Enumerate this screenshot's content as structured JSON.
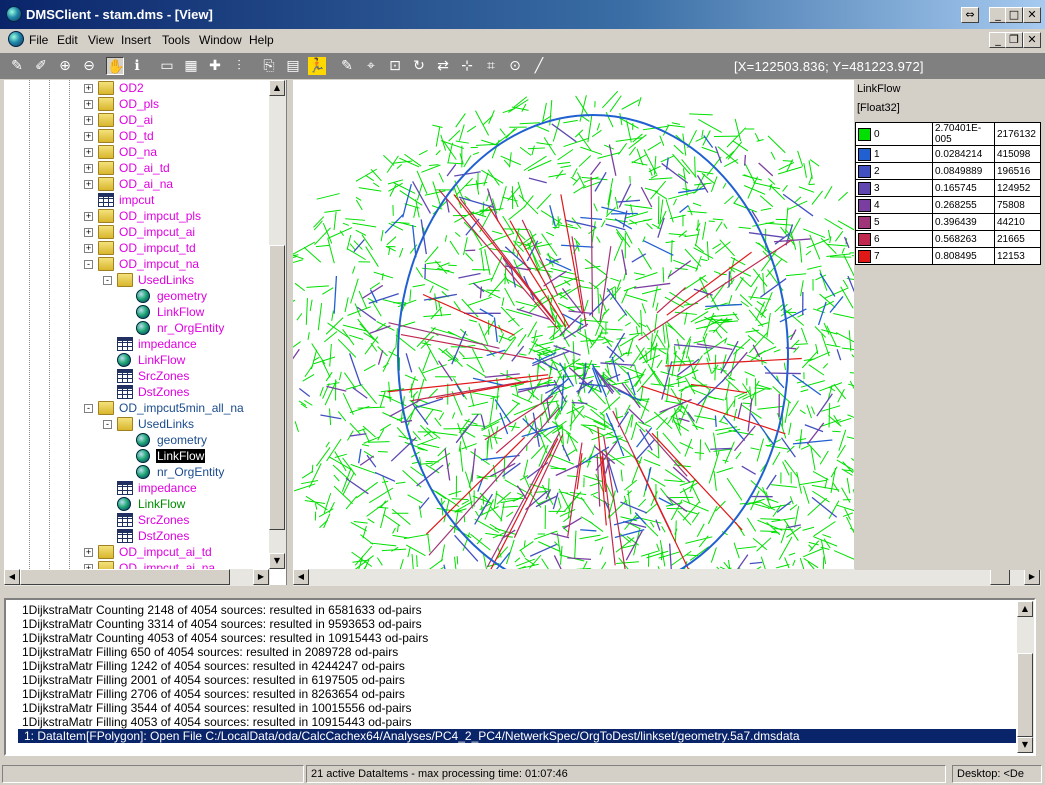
{
  "window": {
    "title": "DMSClient - stam.dms - [View]"
  },
  "menu": [
    "File",
    "Edit",
    "View",
    "Insert",
    "Tools",
    "Window",
    "Help"
  ],
  "toolbar": {
    "coordinates": "[X=122503.836; Y=481223.972]",
    "icons": [
      "pen-icon",
      "edit-pen-icon",
      "zoom-in-icon",
      "zoom-out-icon",
      "hand-pan-icon",
      "info-icon",
      "rectangle-icon",
      "grid-icon",
      "crosshair-icon",
      "split-icon",
      "copy-icon",
      "paste-icon",
      "runner-icon",
      "pen2-icon",
      "dot-icon",
      "select-icon",
      "rotate-icon",
      "move-icon",
      "node-icon",
      "point-icon",
      "target-icon",
      "line-icon"
    ]
  },
  "tree": [
    {
      "label": "OD2",
      "color": "mag",
      "icon": "folder",
      "indent": 0,
      "exp": "+"
    },
    {
      "label": "OD_pls",
      "color": "mag",
      "icon": "folder",
      "indent": 0,
      "exp": "+"
    },
    {
      "label": "OD_ai",
      "color": "mag",
      "icon": "folder",
      "indent": 0,
      "exp": "+"
    },
    {
      "label": "OD_td",
      "color": "mag",
      "icon": "folder",
      "indent": 0,
      "exp": "+"
    },
    {
      "label": "OD_na",
      "color": "mag",
      "icon": "folder",
      "indent": 0,
      "exp": "+"
    },
    {
      "label": "OD_ai_td",
      "color": "mag",
      "icon": "folder",
      "indent": 0,
      "exp": "+"
    },
    {
      "label": "OD_ai_na",
      "color": "mag",
      "icon": "folder",
      "indent": 0,
      "exp": "+"
    },
    {
      "label": "impcut",
      "color": "mag",
      "icon": "table",
      "indent": 0,
      "exp": ""
    },
    {
      "label": "OD_impcut_pls",
      "color": "mag",
      "icon": "folder",
      "indent": 0,
      "exp": "+"
    },
    {
      "label": "OD_impcut_ai",
      "color": "mag",
      "icon": "folder",
      "indent": 0,
      "exp": "+"
    },
    {
      "label": "OD_impcut_td",
      "color": "mag",
      "icon": "folder",
      "indent": 0,
      "exp": "+"
    },
    {
      "label": "OD_impcut_na",
      "color": "mag",
      "icon": "folder",
      "indent": 0,
      "exp": "-"
    },
    {
      "label": "UsedLinks",
      "color": "mag",
      "icon": "folder",
      "indent": 1,
      "exp": "-"
    },
    {
      "label": "geometry",
      "color": "mag",
      "icon": "globe",
      "indent": 2,
      "exp": ""
    },
    {
      "label": "LinkFlow",
      "color": "mag",
      "icon": "globe",
      "indent": 2,
      "exp": ""
    },
    {
      "label": "nr_OrgEntity",
      "color": "mag",
      "icon": "globe",
      "indent": 2,
      "exp": ""
    },
    {
      "label": "impedance",
      "color": "mag",
      "icon": "table",
      "indent": 1,
      "exp": ""
    },
    {
      "label": "LinkFlow",
      "color": "mag",
      "icon": "globe",
      "indent": 1,
      "exp": ""
    },
    {
      "label": "SrcZones",
      "color": "mag",
      "icon": "table",
      "indent": 1,
      "exp": ""
    },
    {
      "label": "DstZones",
      "color": "mag",
      "icon": "table",
      "indent": 1,
      "exp": ""
    },
    {
      "label": "OD_impcut5min_all_na",
      "color": "blu",
      "icon": "folder",
      "indent": 0,
      "exp": "-"
    },
    {
      "label": "UsedLinks",
      "color": "blu",
      "icon": "folder",
      "indent": 1,
      "exp": "-"
    },
    {
      "label": "geometry",
      "color": "blu",
      "icon": "globe",
      "indent": 2,
      "exp": ""
    },
    {
      "label": "LinkFlow",
      "color": "sel",
      "icon": "globe",
      "indent": 2,
      "exp": ""
    },
    {
      "label": "nr_OrgEntity",
      "color": "blu",
      "icon": "globe",
      "indent": 2,
      "exp": ""
    },
    {
      "label": "impedance",
      "color": "mag",
      "icon": "table",
      "indent": 1,
      "exp": ""
    },
    {
      "label": "LinkFlow",
      "color": "grn",
      "icon": "globe",
      "indent": 1,
      "exp": ""
    },
    {
      "label": "SrcZones",
      "color": "mag",
      "icon": "table",
      "indent": 1,
      "exp": ""
    },
    {
      "label": "DstZones",
      "color": "mag",
      "icon": "table",
      "indent": 1,
      "exp": ""
    },
    {
      "label": "OD_impcut_ai_td",
      "color": "mag",
      "icon": "folder",
      "indent": 0,
      "exp": "+"
    },
    {
      "label": "OD_impcut_ai_na",
      "color": "mag",
      "icon": "folder",
      "indent": 0,
      "exp": "+"
    }
  ],
  "legend": {
    "title": "LinkFlow",
    "type": "[Float32]",
    "rows": [
      {
        "cls": "0",
        "value": "2.70401E-005",
        "count": "2176132",
        "color": "#00e000"
      },
      {
        "cls": "1",
        "value": "0.0284214",
        "count": "415098",
        "color": "#2060d0"
      },
      {
        "cls": "2",
        "value": "0.0849889",
        "count": "196516",
        "color": "#4050c0"
      },
      {
        "cls": "3",
        "value": "0.165745",
        "count": "124952",
        "color": "#6048b0"
      },
      {
        "cls": "4",
        "value": "0.268255",
        "count": "75808",
        "color": "#7a3ea0"
      },
      {
        "cls": "5",
        "value": "0.396439",
        "count": "44210",
        "color": "#a03478"
      },
      {
        "cls": "6",
        "value": "0.568263",
        "count": "21665",
        "color": "#c02850"
      },
      {
        "cls": "7",
        "value": "0.808495",
        "count": "12153",
        "color": "#e01818"
      }
    ]
  },
  "log": [
    "1DijkstraMatr Counting 2148 of 4054 sources: resulted in 6581633 od-pairs",
    "1DijkstraMatr Counting 3314 of 4054 sources: resulted in 9593653 od-pairs",
    "1DijkstraMatr Counting 4053 of 4054 sources: resulted in 10915443 od-pairs",
    "1DijkstraMatr Filling 650 of 4054 sources: resulted in 2089728 od-pairs",
    "1DijkstraMatr Filling 1242 of 4054 sources: resulted in 4244247 od-pairs",
    "1DijkstraMatr Filling 2001 of 4054 sources: resulted in 6197505 od-pairs",
    "1DijkstraMatr Filling 2706 of 4054 sources: resulted in 8263654 od-pairs",
    "1DijkstraMatr Filling 3544 of 4054 sources: resulted in 10015556 od-pairs",
    "1DijkstraMatr Filling 4053 of 4054 sources: resulted in 10915443 od-pairs",
    "1: DataItem[FPolygon]: Open   File C:/LocalData/oda/CalcCachex64/Analyses/PC4_2_PC4/NetwerkSpec/OrgToDest/linkset/geometry.5a7.dmsdata"
  ],
  "status": {
    "items": "21 active DataItems - max processing time: 01:07:46",
    "desktop": "Desktop: <De"
  }
}
